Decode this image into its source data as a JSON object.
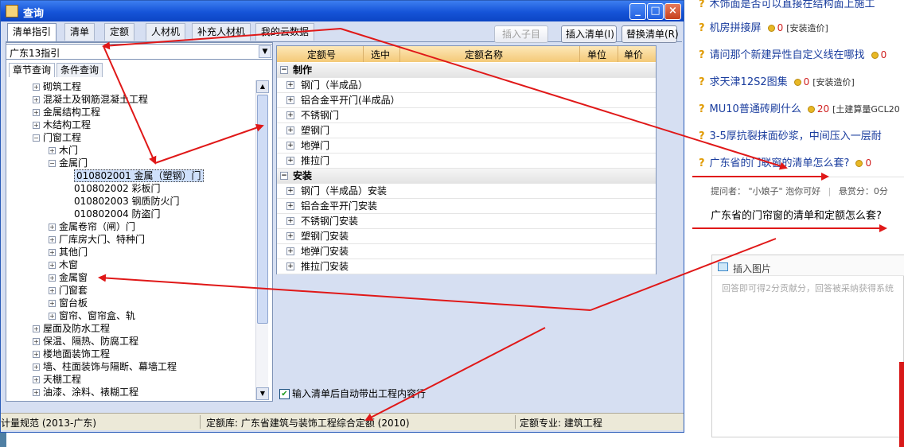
{
  "window": {
    "title": "查询",
    "controls": [
      "_",
      "□",
      "×"
    ]
  },
  "tabs": [
    "清单指引",
    "清单",
    "定额",
    "人材机",
    "补充人材机",
    "我的云数据"
  ],
  "toolbar": {
    "insert_sub": "插入子目",
    "insert_list": "插入清单(I)",
    "replace_list": "替换清单(R)"
  },
  "combo": {
    "value": "广东13指引"
  },
  "subtabs": [
    "章节查询",
    "条件查询"
  ],
  "tree": {
    "items": [
      {
        "label": "砌筑工程",
        "level": 0,
        "exp": "+"
      },
      {
        "label": "混凝土及钢筋混凝土工程",
        "level": 0,
        "exp": "+"
      },
      {
        "label": "金属结构工程",
        "level": 0,
        "exp": "+"
      },
      {
        "label": "木结构工程",
        "level": 0,
        "exp": "+"
      },
      {
        "label": "门窗工程",
        "level": 0,
        "exp": "-"
      },
      {
        "label": "木门",
        "level": 1,
        "exp": "+"
      },
      {
        "label": "金属门",
        "level": 1,
        "exp": "-"
      },
      {
        "label": "010802001   金属（塑钢）门",
        "level": 2,
        "exp": "",
        "selected": true
      },
      {
        "label": "010802002   彩板门",
        "level": 2,
        "exp": ""
      },
      {
        "label": "010802003   钢质防火门",
        "level": 2,
        "exp": ""
      },
      {
        "label": "010802004   防盗门",
        "level": 2,
        "exp": ""
      },
      {
        "label": "金属卷帘（闸）门",
        "level": 1,
        "exp": "+"
      },
      {
        "label": "厂库房大门、特种门",
        "level": 1,
        "exp": "+"
      },
      {
        "label": "其他门",
        "level": 1,
        "exp": "+"
      },
      {
        "label": "木窗",
        "level": 1,
        "exp": "+"
      },
      {
        "label": "金属窗",
        "level": 1,
        "exp": "+"
      },
      {
        "label": "门窗套",
        "level": 1,
        "exp": "+"
      },
      {
        "label": "窗台板",
        "level": 1,
        "exp": "+"
      },
      {
        "label": "窗帘、窗帘盒、轨",
        "level": 1,
        "exp": "+"
      },
      {
        "label": "屋面及防水工程",
        "level": 0,
        "exp": "+"
      },
      {
        "label": "保温、隔热、防腐工程",
        "level": 0,
        "exp": "+"
      },
      {
        "label": "楼地面装饰工程",
        "level": 0,
        "exp": "+"
      },
      {
        "label": "墙、柱面装饰与隔断、幕墙工程",
        "level": 0,
        "exp": "+"
      },
      {
        "label": "天棚工程",
        "level": 0,
        "exp": "+"
      },
      {
        "label": "油漆、涂料、裱糊工程",
        "level": 0,
        "exp": "+"
      }
    ]
  },
  "grid": {
    "columns": [
      "定额号",
      "选中",
      "定额名称",
      "单位",
      "单价"
    ],
    "rows": [
      {
        "type": "group",
        "label": "制作"
      },
      {
        "type": "item",
        "label": "钢门（半成品）"
      },
      {
        "type": "item",
        "label": "铝合金平开门(半成品）"
      },
      {
        "type": "item",
        "label": "不锈钢门"
      },
      {
        "type": "item",
        "label": "塑钢门"
      },
      {
        "type": "item",
        "label": "地弹门"
      },
      {
        "type": "item",
        "label": "推拉门"
      },
      {
        "type": "group",
        "label": "安装"
      },
      {
        "type": "item",
        "label": "钢门（半成品）安装"
      },
      {
        "type": "item",
        "label": "铝合金平开门安装"
      },
      {
        "type": "item",
        "label": "不锈钢门安装"
      },
      {
        "type": "item",
        "label": "塑钢门安装"
      },
      {
        "type": "item",
        "label": "地弹门安装"
      },
      {
        "type": "item",
        "label": "推拉门安装"
      }
    ]
  },
  "checkbox": {
    "label": "输入清单后自动带出工程内容行",
    "checked": true
  },
  "status": {
    "left": "计量规范 (2013-广东)",
    "middle": "定额库: 广东省建筑与装饰工程综合定额 (2010)",
    "right": "定额专业: 建筑工程"
  },
  "web": {
    "questions": [
      {
        "title": "木饰面是否可以直接在结构面上施工",
        "points": "",
        "tag": ""
      },
      {
        "title": "机房拼接屏",
        "points": "0",
        "tag": "[安装造价]"
      },
      {
        "title": "请问那个新建异性自定义线在哪找",
        "points": "0",
        "tag": ""
      },
      {
        "title": "求天津12S2图集",
        "points": "0",
        "tag": "[安装造价]"
      },
      {
        "title": "MU10普通砖刷什么",
        "points": "20",
        "tag": "[土建算量GCL20"
      },
      {
        "title": "3-5厚抗裂抹面砂浆，中间压入一层耐",
        "points": "",
        "tag": ""
      },
      {
        "title": "广东省的门联窗的清单怎么套?",
        "points": "0",
        "tag": ""
      }
    ],
    "asker_label": "提问者：",
    "asker": "\"小娘子\" 泡你可好",
    "reward_label": "悬赏分：0分",
    "question_text": "广东省的门帘窗的清单和定额怎么套?",
    "insert_image": "插入图片",
    "answer_hint": "回答即可得2分贡献分，回答被采纳获得系统"
  },
  "colors": {
    "titlebar": "#1554d8",
    "arrow": "#e01818",
    "link": "#1a3d9e",
    "points": "#d02020"
  }
}
